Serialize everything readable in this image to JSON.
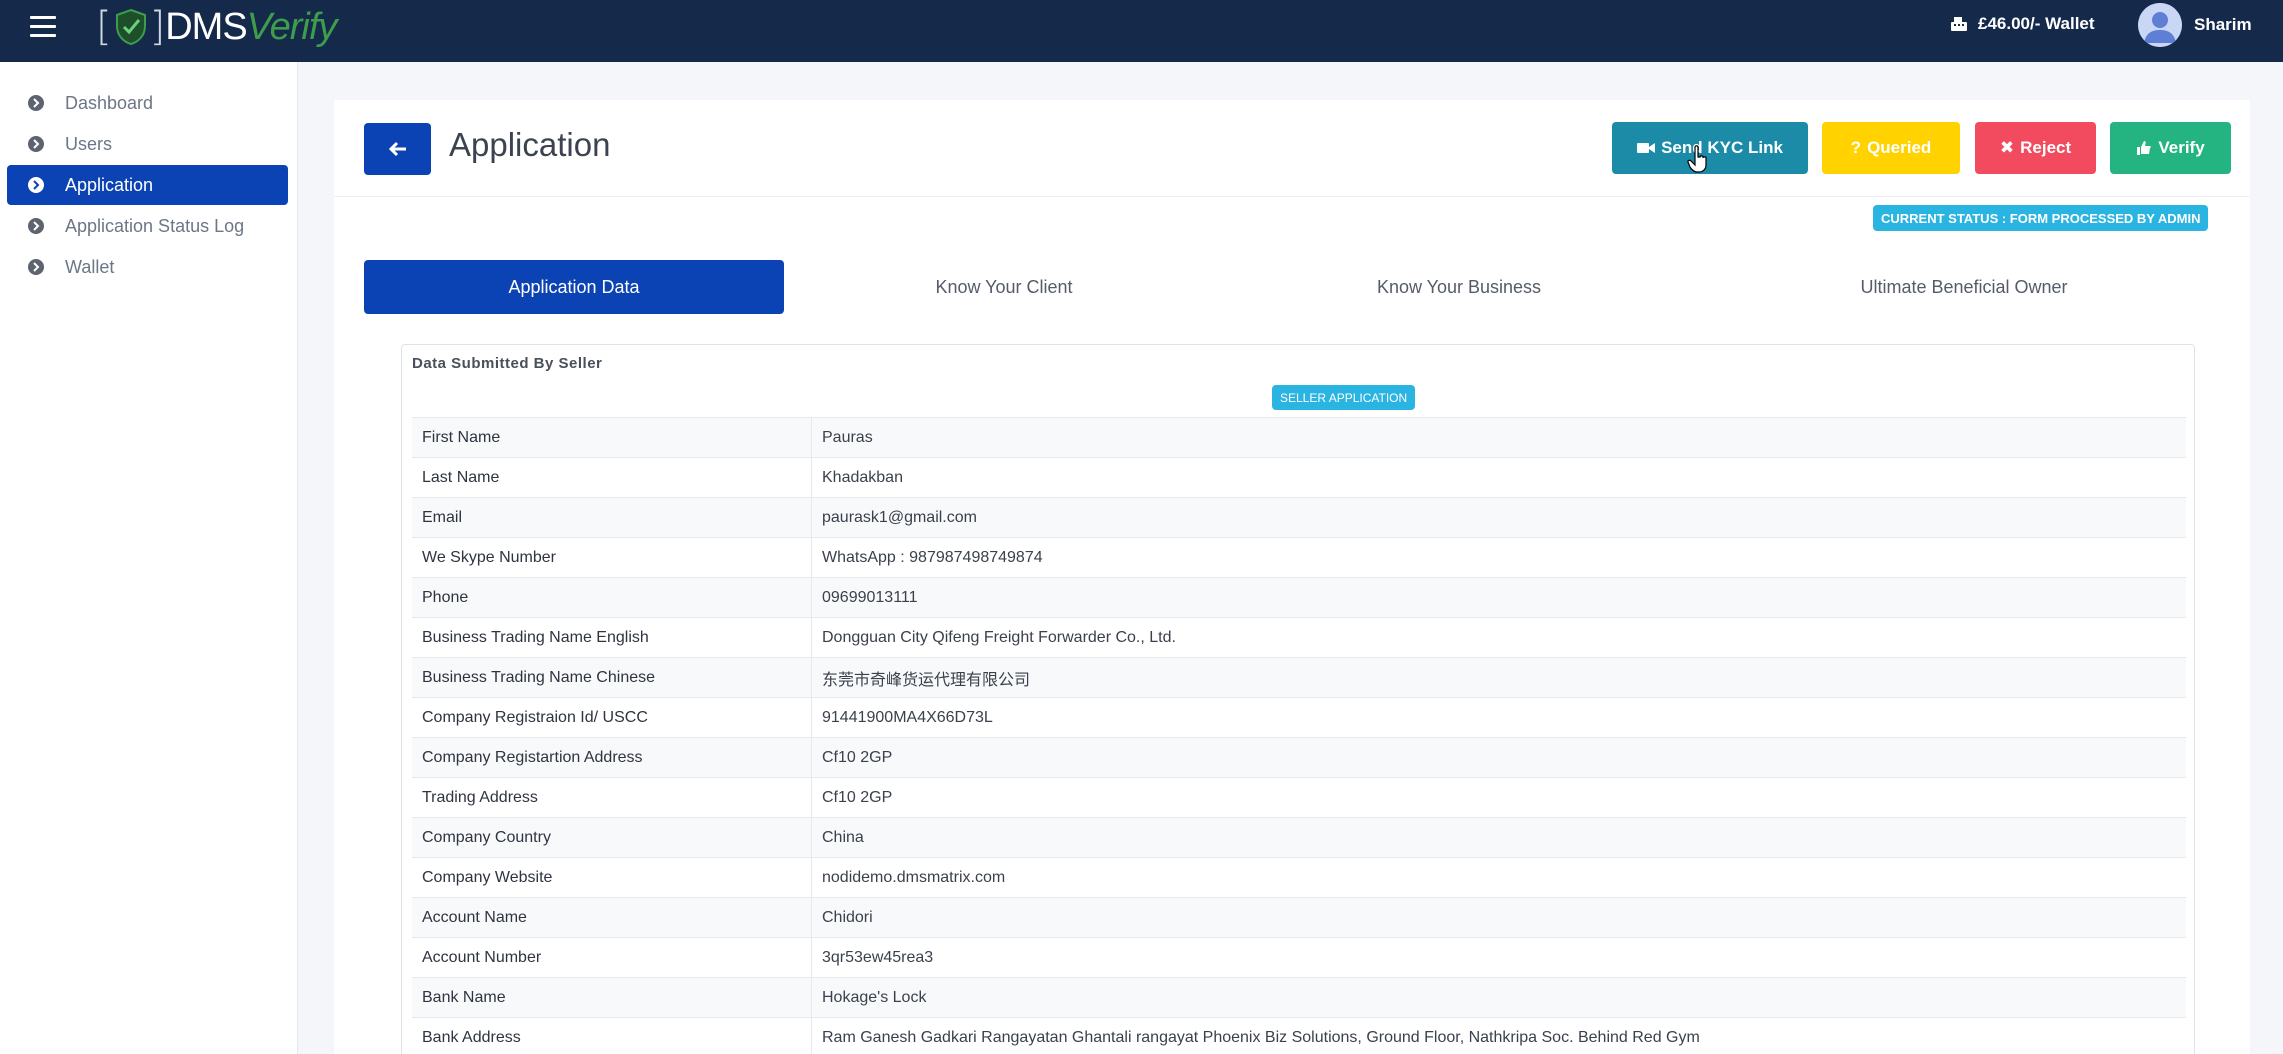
{
  "header": {
    "logo_dms": "DMS",
    "logo_verify": "Verify",
    "wallet_text": "£46.00/- Wallet",
    "user_name": "Sharim"
  },
  "sidebar": {
    "items": [
      {
        "label": "Dashboard"
      },
      {
        "label": "Users"
      },
      {
        "label": "Application"
      },
      {
        "label": "Application Status Log"
      },
      {
        "label": "Wallet"
      }
    ]
  },
  "page": {
    "title": "Application",
    "buttons": {
      "send_kyc": "Send KYC Link",
      "queried": "Queried",
      "reject": "Reject",
      "verify": "Verify"
    },
    "status": "CURRENT STATUS : FORM PROCESSED BY ADMIN",
    "tabs": [
      {
        "label": "Application Data"
      },
      {
        "label": "Know Your Client"
      },
      {
        "label": "Know Your Business"
      },
      {
        "label": "Ultimate Beneficial Owner"
      }
    ]
  },
  "data_box": {
    "title": "Data Submitted By Seller",
    "badge": "SELLER APPLICATION",
    "rows": [
      {
        "label": "First Name",
        "value": "Pauras"
      },
      {
        "label": "Last Name",
        "value": "Khadakban"
      },
      {
        "label": "Email",
        "value": "paurask1@gmail.com"
      },
      {
        "label": "We Skype Number",
        "value": "WhatsApp : 987987498749874"
      },
      {
        "label": "Phone",
        "value": "09699013111"
      },
      {
        "label": "Business Trading Name English",
        "value": "Dongguan City Qifeng Freight Forwarder Co., Ltd."
      },
      {
        "label": "Business Trading Name Chinese",
        "value": "东莞市奇峰货运代理有限公司"
      },
      {
        "label": "Company Registraion Id/ USCC",
        "value": "91441900MA4X66D73L"
      },
      {
        "label": "Company Registartion Address",
        "value": "Cf10 2GP"
      },
      {
        "label": "Trading Address",
        "value": "Cf10 2GP"
      },
      {
        "label": "Company Country",
        "value": "China"
      },
      {
        "label": "Company Website",
        "value": "nodidemo.dmsmatrix.com"
      },
      {
        "label": "Account Name",
        "value": "Chidori"
      },
      {
        "label": "Account Number",
        "value": "3qr53ew45rea3"
      },
      {
        "label": "Bank Name",
        "value": "Hokage's Lock"
      },
      {
        "label": "Bank Address",
        "value": "Ram Ganesh Gadkari Rangayatan Ghantali rangayat Phoenix Biz Solutions, Ground Floor, Nathkripa Soc. Behind Red Gym"
      }
    ]
  },
  "colors": {
    "navbar": "#15294b",
    "primary": "#0c43b4",
    "kyc": "#1c8ba7",
    "queried": "#ffd200",
    "reject": "#f24a5e",
    "verify": "#23b481",
    "badge": "#2ab4e2"
  },
  "icons": {
    "menu": "hamburger-icon",
    "wallet": "cash-register-icon",
    "user": "user-avatar-icon",
    "nav": "chevron-circle-right-icon",
    "back": "arrow-left-icon",
    "kyc": "video-camera-icon",
    "queried": "question-icon",
    "reject": "times-icon",
    "verify": "thumbs-up-icon"
  }
}
